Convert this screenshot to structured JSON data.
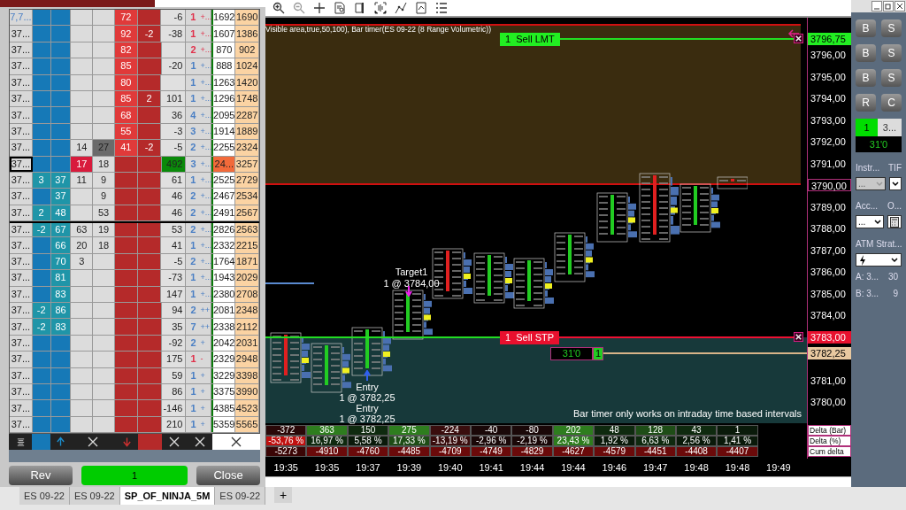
{
  "ladder": {
    "rows": [
      {
        "kind": "plain",
        "price": "7,7...",
        "ask1": "72",
        "delta": "-6",
        "count": "1",
        "sign": "+...",
        "vol1": "1692",
        "vol2": "1690",
        "color": "#e0304a"
      },
      {
        "kind": "plain",
        "price": "37...",
        "ask1": "92",
        "ask2": "-2",
        "delta": "-38",
        "count": "1",
        "sign": "+...",
        "vol1": "1607",
        "vol2": "1386",
        "color": "#e0304a"
      },
      {
        "kind": "plain",
        "price": "37...",
        "ask1": "82",
        "count": "2",
        "sign": "+...",
        "vol1": "870",
        "vol2": "902",
        "color": "#e0304a"
      },
      {
        "kind": "plain",
        "price": "37...",
        "ask1": "85",
        "delta": "-20",
        "count": "1",
        "sign": "+...",
        "vol1": "888",
        "vol2": "1024",
        "color": "#4a7fc4"
      },
      {
        "kind": "plain",
        "price": "37...",
        "ask1": "80",
        "count": "1",
        "sign": "+...",
        "vol1": "1263",
        "vol2": "1420",
        "color": "#4a7fc4"
      },
      {
        "kind": "plain",
        "price": "37...",
        "ask1": "85",
        "ask2": "2",
        "delta": "101",
        "count": "1",
        "sign": "+...",
        "vol1": "1296",
        "vol2": "1748",
        "color": "#4a7fc4"
      },
      {
        "kind": "plain",
        "price": "37...",
        "ask1": "68",
        "delta": "36",
        "count": "4",
        "sign": "+...",
        "vol1": "2095",
        "vol2": "2287",
        "color": "#4a7fc4"
      },
      {
        "kind": "plain",
        "price": "37...",
        "ask1": "55",
        "delta": "-3",
        "count": "3",
        "sign": "+...",
        "vol1": "1914",
        "vol2": "1889",
        "color": "#4a7fc4"
      },
      {
        "kind": "last",
        "price": "37...",
        "c3": "14",
        "c4": "27",
        "ask1": "41",
        "ask2": "-2",
        "delta": "-5",
        "count": "2",
        "sign": "+...",
        "vol1": "2255",
        "vol2": "2324",
        "color": "#4a7fc4"
      },
      {
        "kind": "current",
        "price": "37...",
        "c3": "17",
        "c4": "18",
        "delta": "492",
        "count": "3",
        "sign": "+...",
        "vol1": "24...",
        "vol2": "3257",
        "color": "#4a7fc4"
      },
      {
        "kind": "plain",
        "price": "37...",
        "bid1": "3",
        "bid2": "37",
        "c3": "11",
        "c4": "9",
        "delta": "61",
        "count": "1",
        "sign": "+...",
        "vol1": "2525",
        "vol2": "2729",
        "color": "#4a7fc4"
      },
      {
        "kind": "plain",
        "price": "37...",
        "bid2": "37",
        "c4": "9",
        "delta": "46",
        "count": "2",
        "sign": "+...",
        "vol1": "2467",
        "vol2": "2534",
        "color": "#4a7fc4"
      },
      {
        "kind": "plain",
        "price": "37...",
        "bid1": "2",
        "bid2": "48",
        "c4": "53",
        "delta": "46",
        "count": "2",
        "sign": "+...",
        "vol1": "2491",
        "vol2": "2567",
        "color": "#4a7fc4"
      },
      {
        "kind": "plain",
        "price": "37...",
        "bid1": "-2",
        "bid2": "67",
        "c3": "63",
        "c4": "19",
        "delta": "53",
        "count": "2",
        "sign": "+...",
        "vol1": "2826",
        "vol2": "2563",
        "color": "#4a7fc4"
      },
      {
        "kind": "plain",
        "price": "37...",
        "bid2": "66",
        "c3": "20",
        "c4": "18",
        "delta": "41",
        "count": "1",
        "sign": "+...",
        "vol1": "2332",
        "vol2": "2215",
        "color": "#4a7fc4"
      },
      {
        "kind": "plain",
        "price": "37...",
        "bid2": "70",
        "c3": "3",
        "delta": "-5",
        "count": "2",
        "sign": "+...",
        "vol1": "1764",
        "vol2": "1871",
        "color": "#4a7fc4"
      },
      {
        "kind": "plain",
        "price": "37...",
        "bid2": "81",
        "delta": "-73",
        "count": "1",
        "sign": "+...",
        "vol1": "1943",
        "vol2": "2029",
        "color": "#4a7fc4"
      },
      {
        "kind": "plain",
        "price": "37...",
        "bid2": "83",
        "delta": "147",
        "count": "1",
        "sign": "+...",
        "vol1": "2380",
        "vol2": "2708",
        "color": "#4a7fc4"
      },
      {
        "kind": "plain",
        "price": "37...",
        "bid1": "-2",
        "bid2": "86",
        "delta": "94",
        "count": "2",
        "sign": "++",
        "vol1": "2081",
        "vol2": "2348",
        "color": "#4a7fc4"
      },
      {
        "kind": "plain",
        "price": "37...",
        "bid1": "-2",
        "bid2": "83",
        "delta": "35",
        "count": "7",
        "sign": "++",
        "vol1": "2338",
        "vol2": "2112",
        "color": "#4a7fc4"
      },
      {
        "kind": "plain",
        "price": "37...",
        "delta": "-92",
        "count": "2",
        "sign": "+",
        "vol1": "2042",
        "vol2": "2031",
        "color": "#4a7fc4"
      },
      {
        "kind": "plain",
        "price": "37...",
        "delta": "175",
        "count": "1",
        "sign": "-",
        "vol1": "2329",
        "vol2": "2948",
        "color": "#e0304a"
      },
      {
        "kind": "plain",
        "price": "37...",
        "delta": "59",
        "count": "1",
        "sign": "+",
        "vol1": "3229",
        "vol2": "3398",
        "color": "#4a7fc4"
      },
      {
        "kind": "plain",
        "price": "37...",
        "delta": "86",
        "count": "1",
        "sign": "+",
        "vol1": "3375",
        "vol2": "3990",
        "color": "#4a7fc4"
      },
      {
        "kind": "plain",
        "price": "37...",
        "delta": "-146",
        "count": "1",
        "sign": "+",
        "vol1": "4385",
        "vol2": "4523",
        "color": "#4a7fc4"
      },
      {
        "kind": "plain",
        "price": "37...",
        "delta": "210",
        "count": "1",
        "sign": "+",
        "vol1": "5359",
        "vol2": "5565",
        "color": "#4a7fc4"
      }
    ],
    "buttons": [
      {
        "label": "Rev"
      },
      {
        "label": "1"
      },
      {
        "label": "Close"
      }
    ]
  },
  "chart": {
    "indicator_text": "Visible area,true,50,100), Bar timer(ES 09-22 (8 Range Volumetric))",
    "orders": [
      {
        "label": "1  Sell LMT",
        "kind": "limit"
      },
      {
        "label": "1  Sell STP",
        "kind": "stop"
      }
    ],
    "position": {
      "timer": "31'0",
      "quantity": "1"
    },
    "target": {
      "title": "Target1",
      "detail": "1 @ 3784,00"
    },
    "entries": [
      {
        "title": "Entry",
        "detail": "1 @ 3782,25"
      },
      {
        "title": "Entry",
        "detail": "1 @ 3782,25"
      }
    ],
    "notice": "Bar timer only works on intraday time based intervals",
    "price_axis": [
      {
        "text": "3796,75",
        "kind": "limit"
      },
      {
        "text": "3796,00",
        "kind": "plain"
      },
      {
        "text": "3795,00",
        "kind": "plain"
      },
      {
        "text": "3794,00",
        "kind": "plain"
      },
      {
        "text": "3793,00",
        "kind": "plain"
      },
      {
        "text": "3792,00",
        "kind": "plain"
      },
      {
        "text": "3791,00",
        "kind": "plain"
      },
      {
        "text": "3790,00",
        "kind": "boxed"
      },
      {
        "text": "3789,00",
        "kind": "plain"
      },
      {
        "text": "3788,00",
        "kind": "plain"
      },
      {
        "text": "3787,00",
        "kind": "plain"
      },
      {
        "text": "3786,00",
        "kind": "plain"
      },
      {
        "text": "3785,00",
        "kind": "plain"
      },
      {
        "text": "3784,00",
        "kind": "plain"
      },
      {
        "text": "3783,00",
        "kind": "stop"
      },
      {
        "text": "3782,25",
        "kind": "position"
      },
      {
        "text": "3781,00",
        "kind": "plain"
      },
      {
        "text": "3780,00",
        "kind": "plain"
      }
    ],
    "delta_table": [
      {
        "label": "Delta (Bar)",
        "cells": [
          {
            "text": "-372",
            "color": "#2a0808"
          },
          {
            "text": "363",
            "color": "#2e7d1e"
          },
          {
            "text": "150",
            "color": "#0f2a0f"
          },
          {
            "text": "275",
            "color": "#2e7d1e"
          },
          {
            "text": "-224",
            "color": "#3a0e0e"
          },
          {
            "text": "-40",
            "color": "#1a0808"
          },
          {
            "text": "-80",
            "color": "#1a0808"
          },
          {
            "text": "202",
            "color": "#2e7d1e"
          },
          {
            "text": "48",
            "color": "#0f2a0f"
          },
          {
            "text": "128",
            "color": "#1e4d16"
          },
          {
            "text": "43",
            "color": "#0f2a0f"
          },
          {
            "text": "1",
            "color": "#0a1a0a"
          }
        ]
      },
      {
        "label": "Delta (%)",
        "cells": [
          {
            "text": "-53,76 %",
            "color": "#c0100f"
          },
          {
            "text": "16,97 %",
            "color": "#0f2a0f"
          },
          {
            "text": "5,58 %",
            "color": "#0a1a0a"
          },
          {
            "text": "17,33 %",
            "color": "#1e4d16"
          },
          {
            "text": "-13,19 %",
            "color": "#3a0e0e"
          },
          {
            "text": "-2,96 %",
            "color": "#1a0808"
          },
          {
            "text": "-2,19 %",
            "color": "#1a0808"
          },
          {
            "text": "23,43 %",
            "color": "#2e7d1e"
          },
          {
            "text": "1,92 %",
            "color": "#0a1a0a"
          },
          {
            "text": "6,63 %",
            "color": "#0f2a0f"
          },
          {
            "text": "2,56 %",
            "color": "#0a1a0a"
          },
          {
            "text": "1,41 %",
            "color": "#0a1a0a"
          }
        ]
      },
      {
        "label": "Cum delta",
        "cells": [
          {
            "text": "-5273",
            "color": "#3a0505"
          },
          {
            "text": "-4910",
            "color": "#6b0a0a"
          },
          {
            "text": "-4760",
            "color": "#6b0a0a"
          },
          {
            "text": "-4485",
            "color": "#6b0a0a"
          },
          {
            "text": "-4709",
            "color": "#6b0a0a"
          },
          {
            "text": "-4749",
            "color": "#6b0a0a"
          },
          {
            "text": "-4829",
            "color": "#6b0a0a"
          },
          {
            "text": "-4627",
            "color": "#6b0a0a"
          },
          {
            "text": "-4579",
            "color": "#6b0a0a"
          },
          {
            "text": "-4451",
            "color": "#6b0a0a"
          },
          {
            "text": "-4408",
            "color": "#6b0a0a"
          },
          {
            "text": "-4407",
            "color": "#6b0a0a"
          }
        ]
      }
    ],
    "times": [
      "19:35",
      "19:35",
      "19:37",
      "19:39",
      "19:40",
      "19:41",
      "19:44",
      "19:44",
      "19:46",
      "19:47",
      "19:48",
      "19:48",
      "19:49"
    ]
  },
  "order_panel": {
    "buttons": [
      "B",
      "S",
      "B",
      "S",
      "B",
      "S",
      "R",
      "C"
    ],
    "position_qty": "1",
    "position_price": "3...",
    "timer": "31'0",
    "fields": [
      {
        "label": "Instr...",
        "kind": "select",
        "disabled": true,
        "value": "..."
      },
      {
        "label": "TIF",
        "kind": "select",
        "disabled": false
      },
      {
        "label": "Acc...",
        "kind": "select",
        "disabled": false,
        "value": "..."
      },
      {
        "label": "O...",
        "kind": "calculator",
        "disabled": false
      }
    ],
    "atm_label": "ATM Strat...",
    "quotes": [
      {
        "label": "A: 3...",
        "value": "30"
      },
      {
        "label": "B: 3...",
        "value": "9"
      }
    ]
  },
  "tabs": [
    {
      "label": "ES 09-22",
      "selected": false
    },
    {
      "label": "ES 09-22",
      "selected": false
    },
    {
      "label": "SP_OF_NINJA_5M",
      "selected": true
    },
    {
      "label": "ES 09-22",
      "selected": false
    }
  ],
  "add_tab": "+"
}
